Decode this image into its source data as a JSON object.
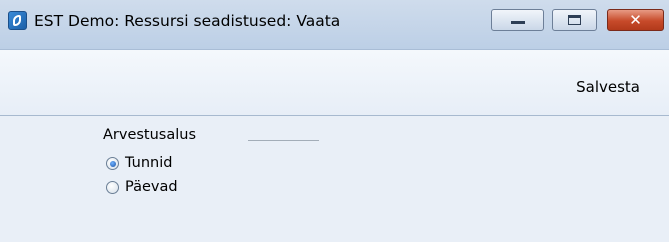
{
  "window": {
    "title": "EST Demo: Ressursi seadistused: Vaata",
    "close_glyph": "✕"
  },
  "toolbar": {
    "save_label": "Salvesta"
  },
  "form": {
    "group_label": "Arvestusalus",
    "options": [
      {
        "label": "Tunnid",
        "checked": true
      },
      {
        "label": "Päevad",
        "checked": false
      }
    ]
  }
}
